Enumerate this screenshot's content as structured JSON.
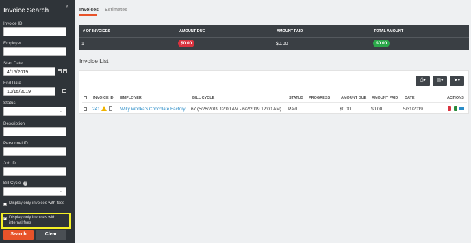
{
  "sidebar": {
    "title": "Invoice Search",
    "collapse_glyph": "«",
    "invoice_id_label": "Invoice ID",
    "employer_label": "Employer",
    "start_date_label": "Start Date",
    "start_date_value": "4/15/2019",
    "end_date_label": "End Date",
    "end_date_value": "10/15/2019",
    "status_label": "Status",
    "description_label": "Description",
    "personnel_id_label": "Personnel ID",
    "job_id_label": "Job ID",
    "bill_cycle_label": "Bill Cycle",
    "help_glyph": "?",
    "fees_checkbox_label": "Display only invoices with fees",
    "fees_checked": false,
    "internal_fees_checkbox_label": "Display only invoices with internal fees",
    "internal_fees_checked": true,
    "search_button": "Search",
    "clear_button": "Clear"
  },
  "tabs": [
    {
      "label": "Invoices",
      "active": true
    },
    {
      "label": "Estimates",
      "active": false
    }
  ],
  "summary": {
    "headers": [
      "# OF INVOICES",
      "AMOUNT DUE",
      "AMOUNT PAID",
      "TOTAL AMOUNT"
    ],
    "num_invoices": "1",
    "amount_due": "$0.00",
    "amount_paid": "$0.00",
    "total_amount": "$0.00"
  },
  "invoice_list": {
    "title": "Invoice List",
    "columns": [
      "INVOICE ID",
      "EMPLOYER",
      "BILL CYCLE",
      "STATUS",
      "PROGRESS",
      "AMOUNT DUE",
      "AMOUNT PAID",
      "DATE",
      "ACTIONS"
    ],
    "rows": [
      {
        "invoice_id": "241",
        "employer": "Willy Wonka's Chocolate Factory",
        "bill_cycle": "67 (5/26/2019 12:00 AM - 6/2/2019 12:00 AM)",
        "status": "Paid",
        "progress": "",
        "amount_due": "$0.00",
        "amount_paid": "$0.00",
        "date": "5/31/2019"
      }
    ],
    "toolbar_icons": [
      "print-icon",
      "export-icon",
      "send-icon"
    ]
  },
  "colors": {
    "accent": "#e8532a",
    "sidebar_bg": "#2f3439",
    "due_pill": "#d9333f",
    "total_pill": "#2ba84a",
    "link": "#2a8cc7",
    "highlight": "#f5f025"
  }
}
